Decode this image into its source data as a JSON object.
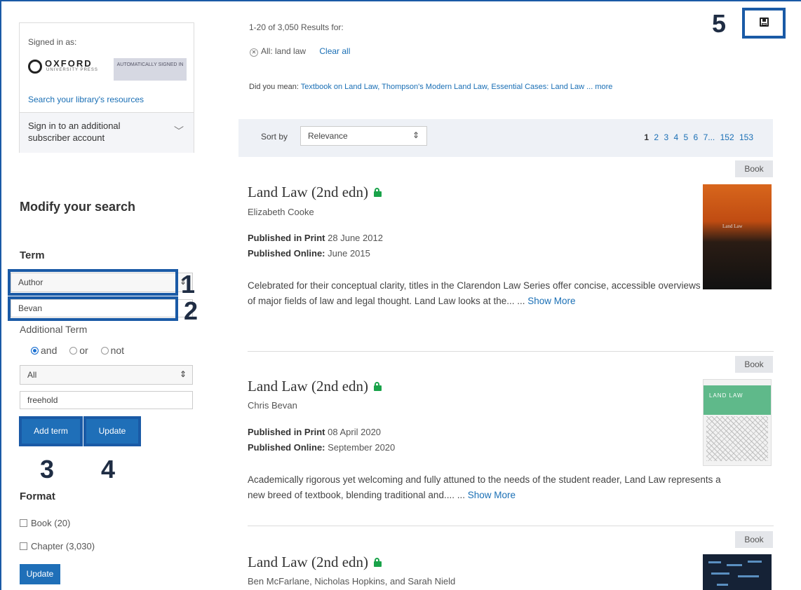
{
  "sidebar": {
    "signed_in_as": "Signed in as:",
    "oup_name": "OXFORD",
    "oup_sub": "UNIVERSITY PRESS",
    "auto_badge": "AUTOMATICALLY SIGNED IN",
    "library_link": "Search your library's resources",
    "additional_signin": "Sign in to an additional subscriber account",
    "modify_title": "Modify your search",
    "term_heading": "Term",
    "term_field": "Author",
    "term_value": "Bevan",
    "additional_term_label": "Additional Term",
    "radio_options": [
      "and",
      "or",
      "not"
    ],
    "radio_selected": "and",
    "additional_field": "All",
    "additional_value": "freehold",
    "add_term_label": "Add term",
    "update_label": "Update",
    "format_heading": "Format",
    "format_options": [
      {
        "label": "Book (20)",
        "checked": false
      },
      {
        "label": "Chapter (3,030)",
        "checked": false
      }
    ],
    "format_update_label": "Update"
  },
  "annotations": [
    "1",
    "2",
    "3",
    "4",
    "5"
  ],
  "results": {
    "count_text": "1-20 of 3,050 Results for:",
    "active_filter": "All: land law",
    "clear_all": "Clear all",
    "did_you_mean_prefix": "Did you mean:",
    "did_you_mean_links": "Textbook on Land Law, Thompson's Modern Land Law, Essential Cases: Land Law ... more",
    "sort_label": "Sort by",
    "sort_value": "Relevance",
    "pages": [
      "1",
      "2",
      "3",
      "4",
      "5",
      "6",
      "7...",
      "152",
      "153"
    ],
    "items": [
      {
        "tag": "Book",
        "title": "Land Law (2nd edn)",
        "author": "Elizabeth Cooke",
        "print_label": "Published in Print",
        "print_date": "28 June 2012",
        "online_label": "Published Online:",
        "online_date": "June 2015",
        "description": "Celebrated for their conceptual clarity, titles in the Clarendon Law Series offer concise, accessible overviews of major fields of law and legal thought. Land Law looks at the... ...",
        "show_more": "Show More",
        "cover_text": "Land Law"
      },
      {
        "tag": "Book",
        "title": "Land Law (2nd edn)",
        "author": "Chris Bevan",
        "print_label": "Published in Print",
        "print_date": "08 April 2020",
        "online_label": "Published Online:",
        "online_date": "September 2020",
        "description": "Academically rigorous yet welcoming and fully attuned to the needs of the student reader, Land Law represents a new breed of textbook, blending traditional and.... ...",
        "show_more": "Show More",
        "cover_text": "LAND LAW"
      },
      {
        "tag": "Book",
        "title": "Land Law (2nd edn)",
        "author": "Ben McFarlane, Nicholas Hopkins, and Sarah Nield"
      }
    ]
  },
  "colors": {
    "accent": "#1a5aa6",
    "button": "#1f6fb8",
    "link": "#1a6fb5",
    "lock": "#1aa34a"
  },
  "icons": [
    "save-icon",
    "lock-icon",
    "chevron-down-icon",
    "sort-arrows-icon",
    "clear-filter-icon"
  ]
}
